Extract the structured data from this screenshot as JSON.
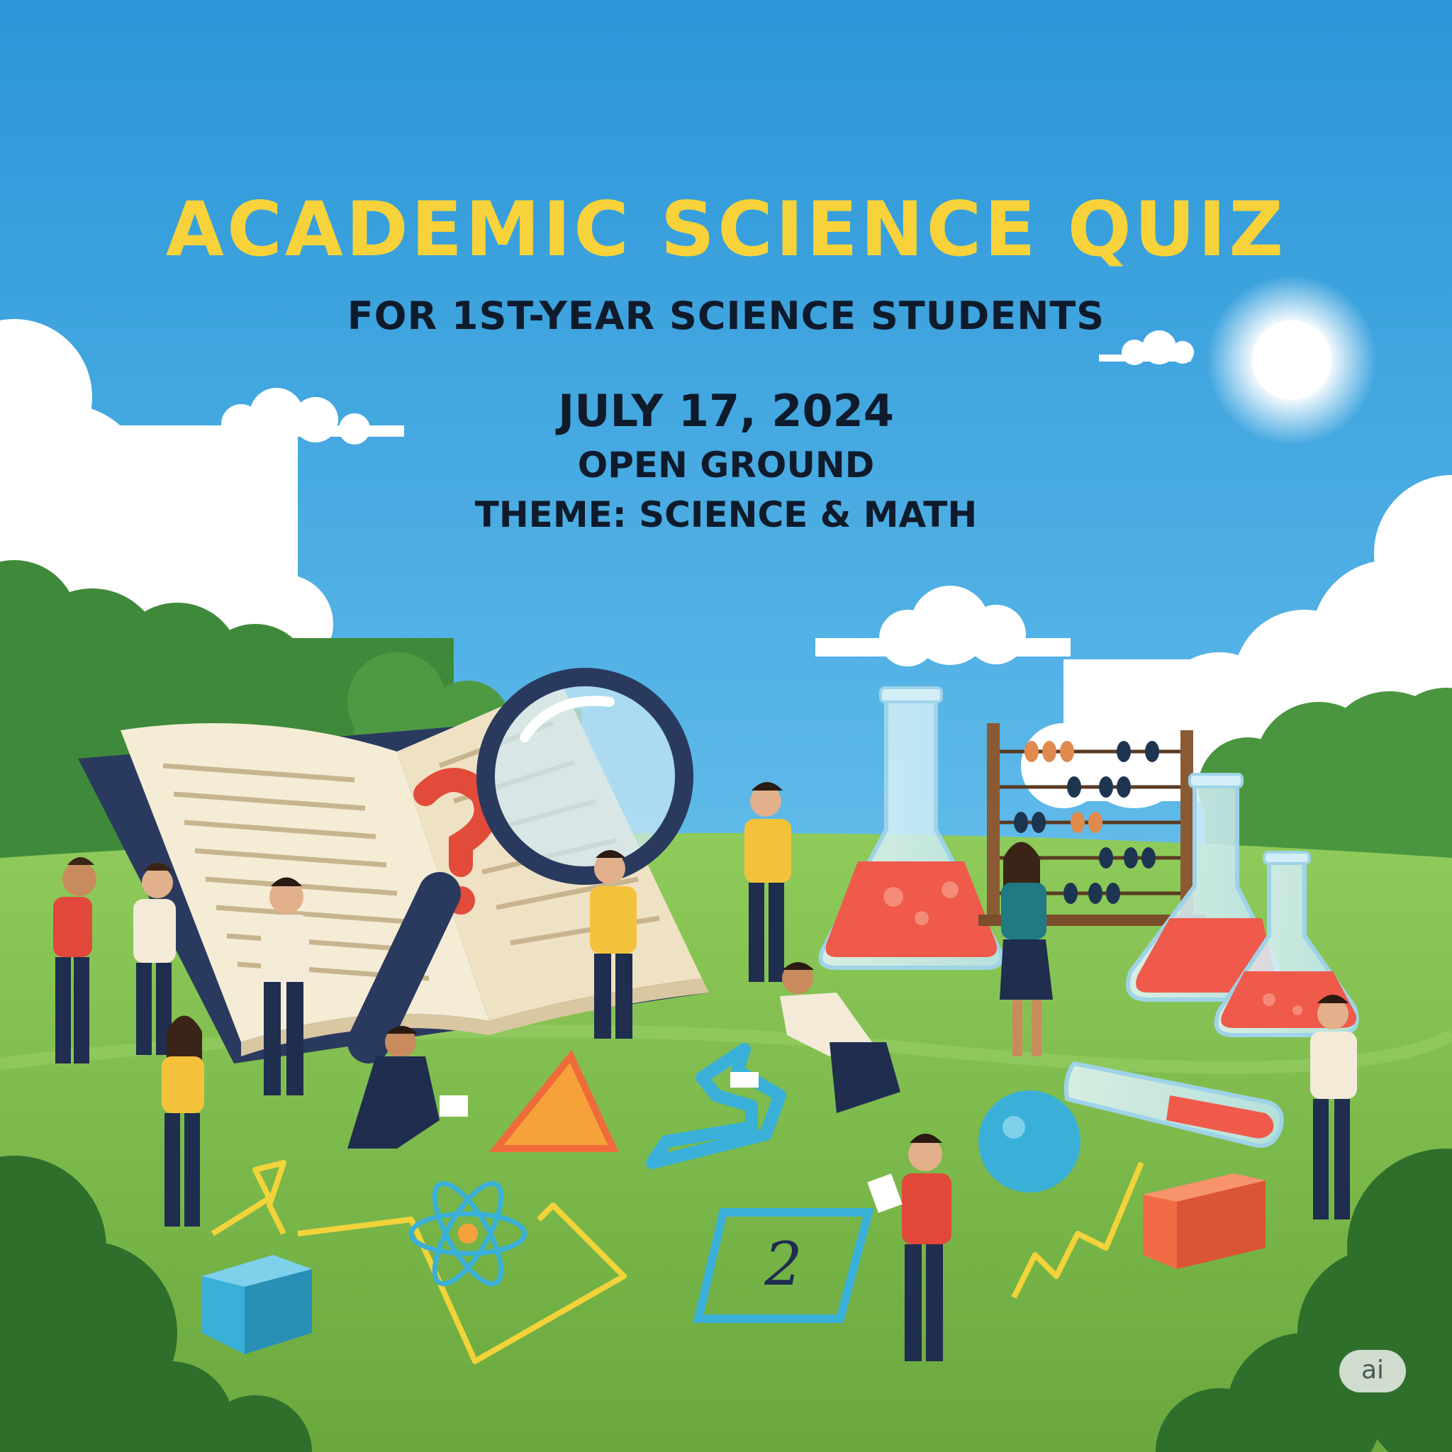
{
  "title": "ACADEMIC SCIENCE QUIZ",
  "subtitle": "FOR 1ST-YEAR SCIENCE STUDENTS",
  "date": "JULY 17, 2024",
  "venue": "OPEN GROUND",
  "theme": "THEME: SCIENCE & MATH",
  "floor_number": "2",
  "badge": "ai",
  "colors": {
    "sky_top": "#2a96d8",
    "sky_bottom": "#a8dcf2",
    "grass": "#7fbf4f",
    "title": "#f7d23a",
    "text": "#0f1a2b",
    "liquid": "#ef5a4a",
    "shape_blue": "#3ab0d8",
    "shape_orange": "#f6a23a",
    "chalk_yellow": "#f2d33a"
  }
}
